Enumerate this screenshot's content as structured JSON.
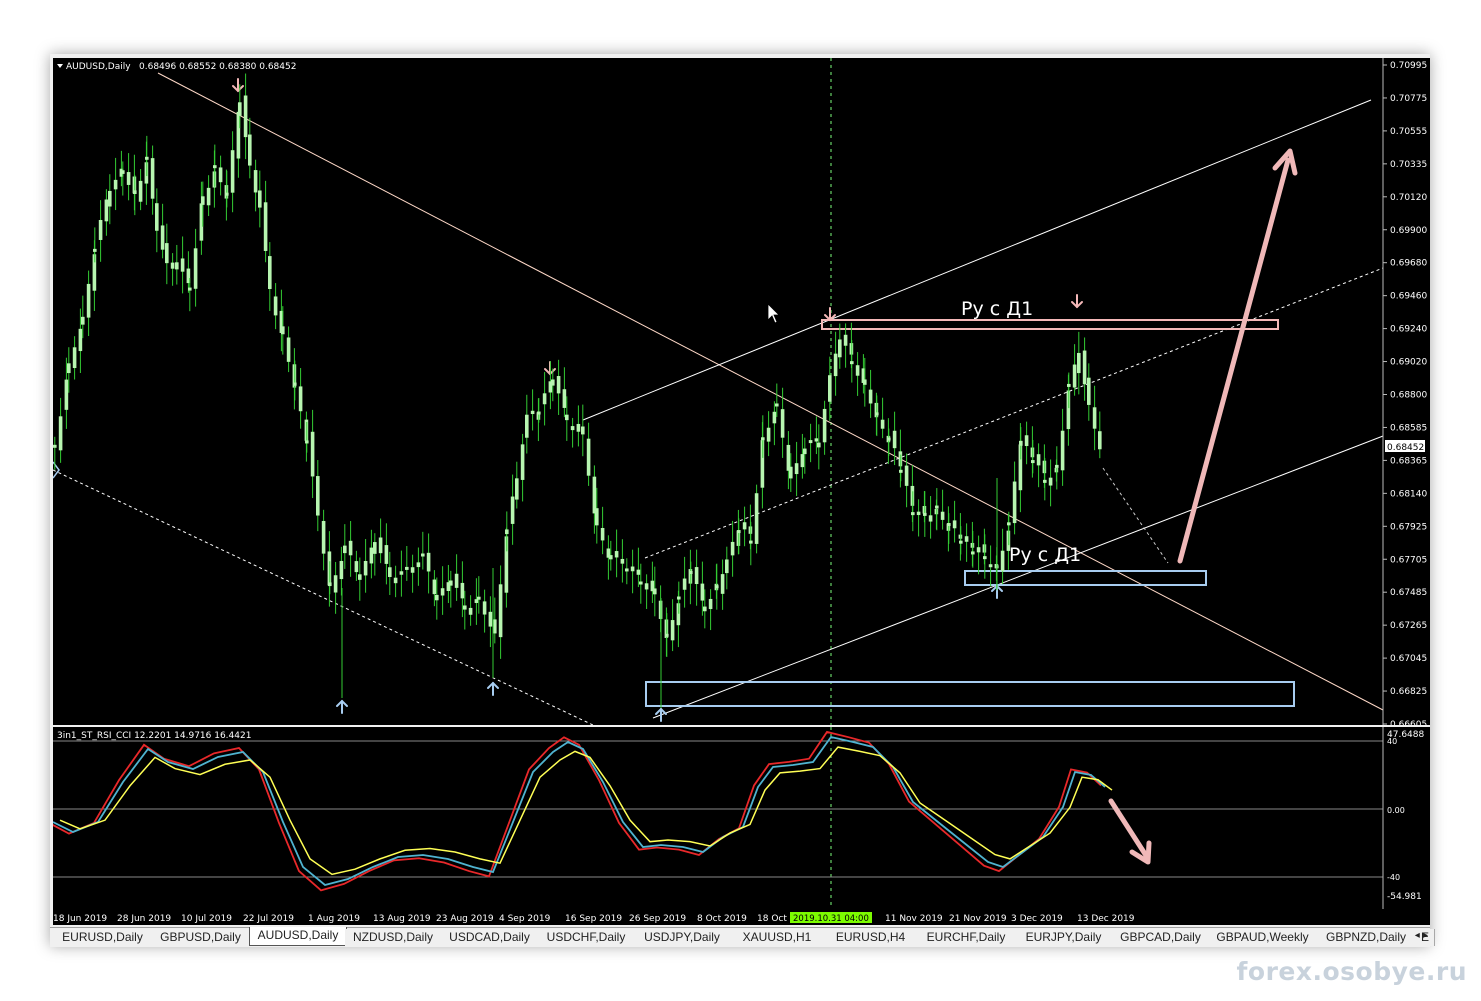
{
  "chart": {
    "symbol_header": "AUDUSD,Daily",
    "ohlc_header": "0.68496 0.68552 0.68380 0.68452",
    "current_price_label": "0.68452",
    "price_levels": [
      "0.70995",
      "0.70775",
      "0.70555",
      "0.70335",
      "0.70120",
      "0.69900",
      "0.69680",
      "0.69460",
      "0.69240",
      "0.69020",
      "0.68800",
      "0.68585",
      "0.68365",
      "0.68140",
      "0.67925",
      "0.67705",
      "0.67485",
      "0.67265",
      "0.67045",
      "0.66825",
      "0.66605"
    ],
    "annotation_top": "Ру с Д1",
    "annotation_bottom": "Ру с Д1"
  },
  "indicator": {
    "header": "3in1_ST_RSI_CCI 12.2201 14.9716 16.4421",
    "scale_labels": [
      "47.6488",
      "40",
      "0.00",
      "-40",
      "-54.981"
    ]
  },
  "time_axis": {
    "labels": [
      "18 Jun 2019",
      "28 Jun 2019",
      "10 Jul 2019",
      "22 Jul 2019",
      "1 Aug 2019",
      "13 Aug 2019",
      "23 Aug 2019",
      "4 Sep 2019",
      "16 Sep 2019",
      "26 Sep 2019",
      "8 Oct 2019",
      "18 Oct",
      "11 Nov 2019",
      "21 Nov 2019",
      "3 Dec 2019",
      "13 Dec 2019"
    ],
    "crosshair_label": "2019.10.31 04:00"
  },
  "tabs": [
    "EURUSD,Daily",
    "GBPUSD,Daily",
    "AUDUSD,Daily",
    "NZDUSD,Daily",
    "USDCAD,Daily",
    "USDCHF,Daily",
    "USDJPY,Daily",
    "XAUUSD,H1",
    "EURUSD,H4",
    "EURCHF,Daily",
    "EURJPY,Daily",
    "GBPCAD,Daily",
    "GBPAUD,Weekly",
    "GBPNZD,Daily",
    "E"
  ],
  "active_tab": "AUDUSD,Daily",
  "tab_scroll": "◂ ▸",
  "watermark": "forex.osobye.ru",
  "colors": {
    "candle": "#b7f5b0",
    "wick": "#33cc33",
    "channel": "#ffffff",
    "trendline": "#ffd9c8",
    "pink_arrow": "#f4b8b8",
    "blue_arrow": "#a8cdf0",
    "stoch_red": "#e8282a",
    "stoch_blue": "#4fb3d0",
    "stoch_yellow": "#ffff55"
  },
  "icons": [
    "dropdown-triangle-icon",
    "fractal-up-arrow-icon",
    "fractal-down-arrow-icon",
    "cursor-icon"
  ]
}
